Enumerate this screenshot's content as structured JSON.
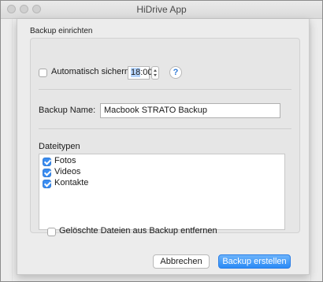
{
  "window": {
    "title": "HiDrive App"
  },
  "sheet": {
    "section_label": "Backup einrichten",
    "auto_backup": {
      "label": "Automatisch sichern",
      "checked": false,
      "time_hour": "18",
      "time_rest": ":00"
    },
    "help": {
      "glyph": "?"
    },
    "backup_name": {
      "label": "Backup Name:",
      "value": "Macbook STRATO Backup"
    },
    "filetypes": {
      "label": "Dateitypen",
      "items": [
        {
          "label": "Fotos",
          "checked": true
        },
        {
          "label": "Videos",
          "checked": true
        },
        {
          "label": "Kontakte",
          "checked": true
        }
      ]
    },
    "remove_deleted": {
      "label": "Gelöschte Dateien aus Backup entfernen",
      "checked": false
    },
    "buttons": {
      "cancel": "Abbrechen",
      "create": "Backup erstellen"
    }
  },
  "colors": {
    "accent": "#2a8af6",
    "time_selection": "#b5d4fb"
  }
}
